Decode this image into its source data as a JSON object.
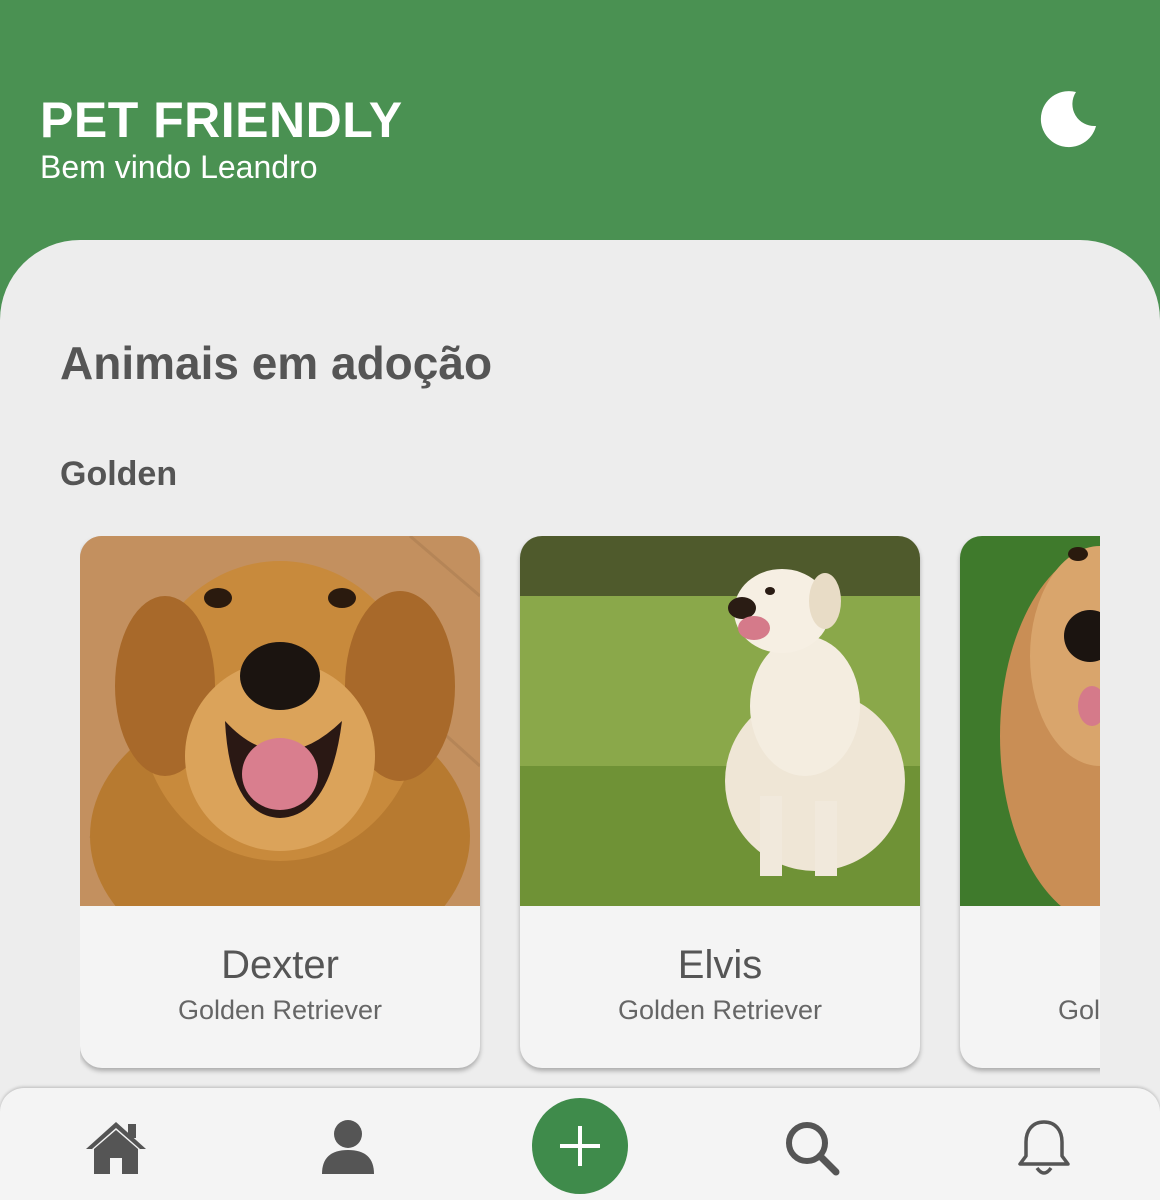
{
  "header": {
    "title": "PET FRIENDLY",
    "welcome": "Bem vindo Leandro",
    "theme_icon": "moon-icon"
  },
  "main": {
    "section_title": "Animais em adoção",
    "breed_group": "Golden",
    "pets": [
      {
        "name": "Dexter",
        "breed": "Golden Retriever"
      },
      {
        "name": "Elvis",
        "breed": "Golden Retriever"
      },
      {
        "name": "",
        "breed": "Golden Retriever"
      }
    ]
  },
  "bottom_nav": {
    "icons": [
      "home-icon",
      "user-icon",
      "plus-icon",
      "search-icon",
      "bell-icon"
    ]
  },
  "colors": {
    "brand_green": "#4a9152",
    "fab_green": "#3f8b4b",
    "background": "#ededed",
    "card": "#f4f4f4",
    "text": "#555555"
  }
}
